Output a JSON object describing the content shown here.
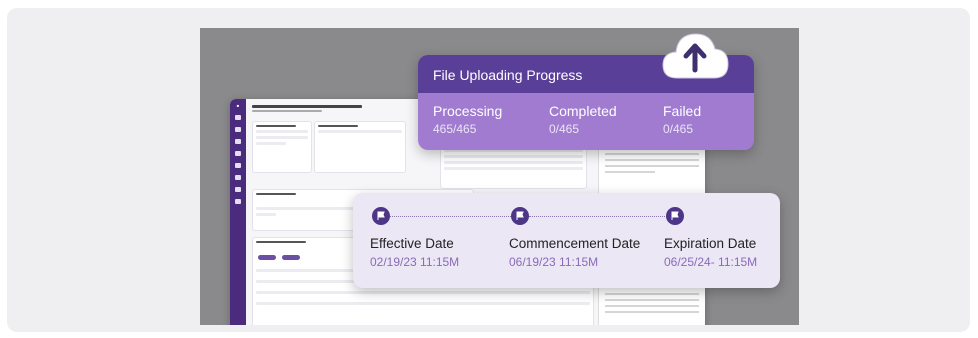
{
  "upload_card": {
    "title": "File Uploading Progress",
    "stats": [
      {
        "label": "Processing",
        "value": "465/465"
      },
      {
        "label": "Completed",
        "value": "0/465"
      },
      {
        "label": "Failed",
        "value": "0/465"
      }
    ],
    "icon": "cloud-upload-icon"
  },
  "timeline": {
    "events": [
      {
        "name": "Effective Date",
        "date": "02/19/23  11:15M",
        "icon": "flag-icon"
      },
      {
        "name": "Commencement Date",
        "date": "06/19/23  11:15M",
        "icon": "flag-icon"
      },
      {
        "name": "Expiration Date",
        "date": "06/25/24-  11:15M",
        "icon": "flag-icon"
      }
    ]
  },
  "colors": {
    "header_purple": "#5a3f99",
    "body_purple": "#a07bcf",
    "timeline_bg": "#ece7f5",
    "flag": "#4d3588",
    "date_text": "#8a6ab8"
  }
}
